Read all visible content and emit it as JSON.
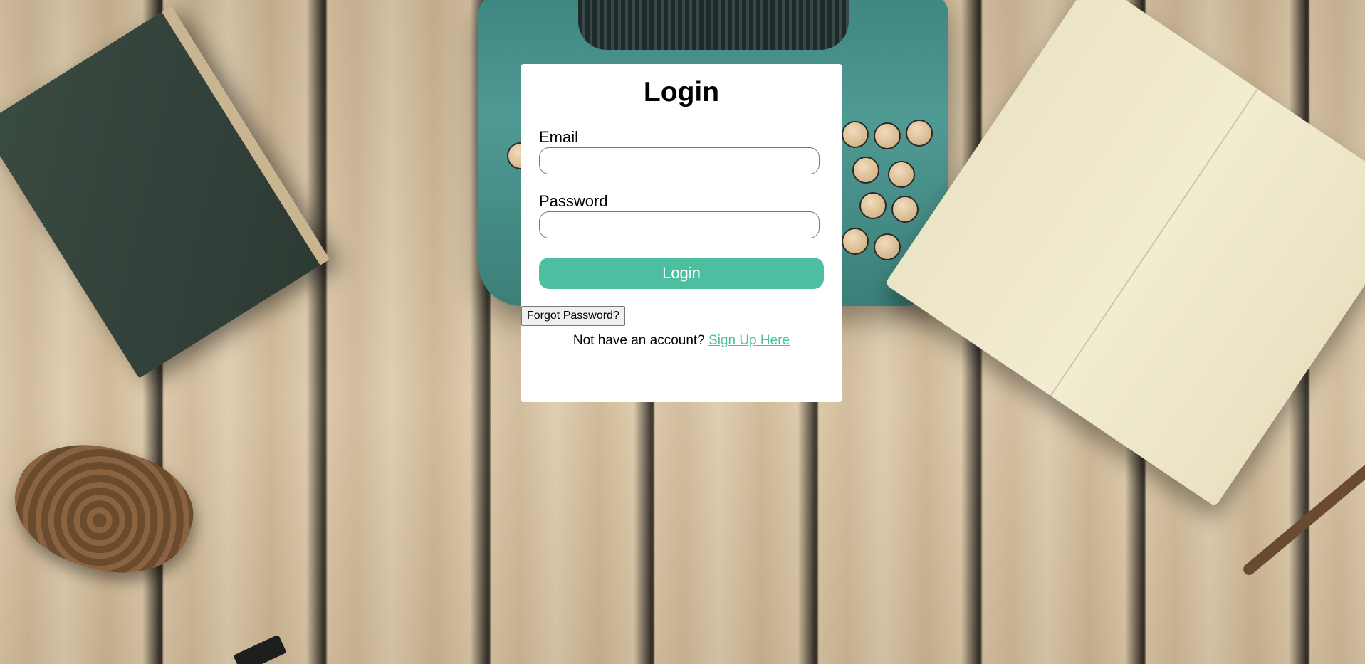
{
  "login": {
    "title": "Login",
    "email_label": "Email",
    "email_value": "",
    "password_label": "Password",
    "password_value": "",
    "submit_label": "Login",
    "forgot_label": "Forgot Password?",
    "signup_prompt": "Not have an account?",
    "signup_link": "Sign Up Here"
  },
  "colors": {
    "accent": "#4bbfa0",
    "card_background": "#ffffff"
  },
  "icons": [
    "background-photo"
  ]
}
